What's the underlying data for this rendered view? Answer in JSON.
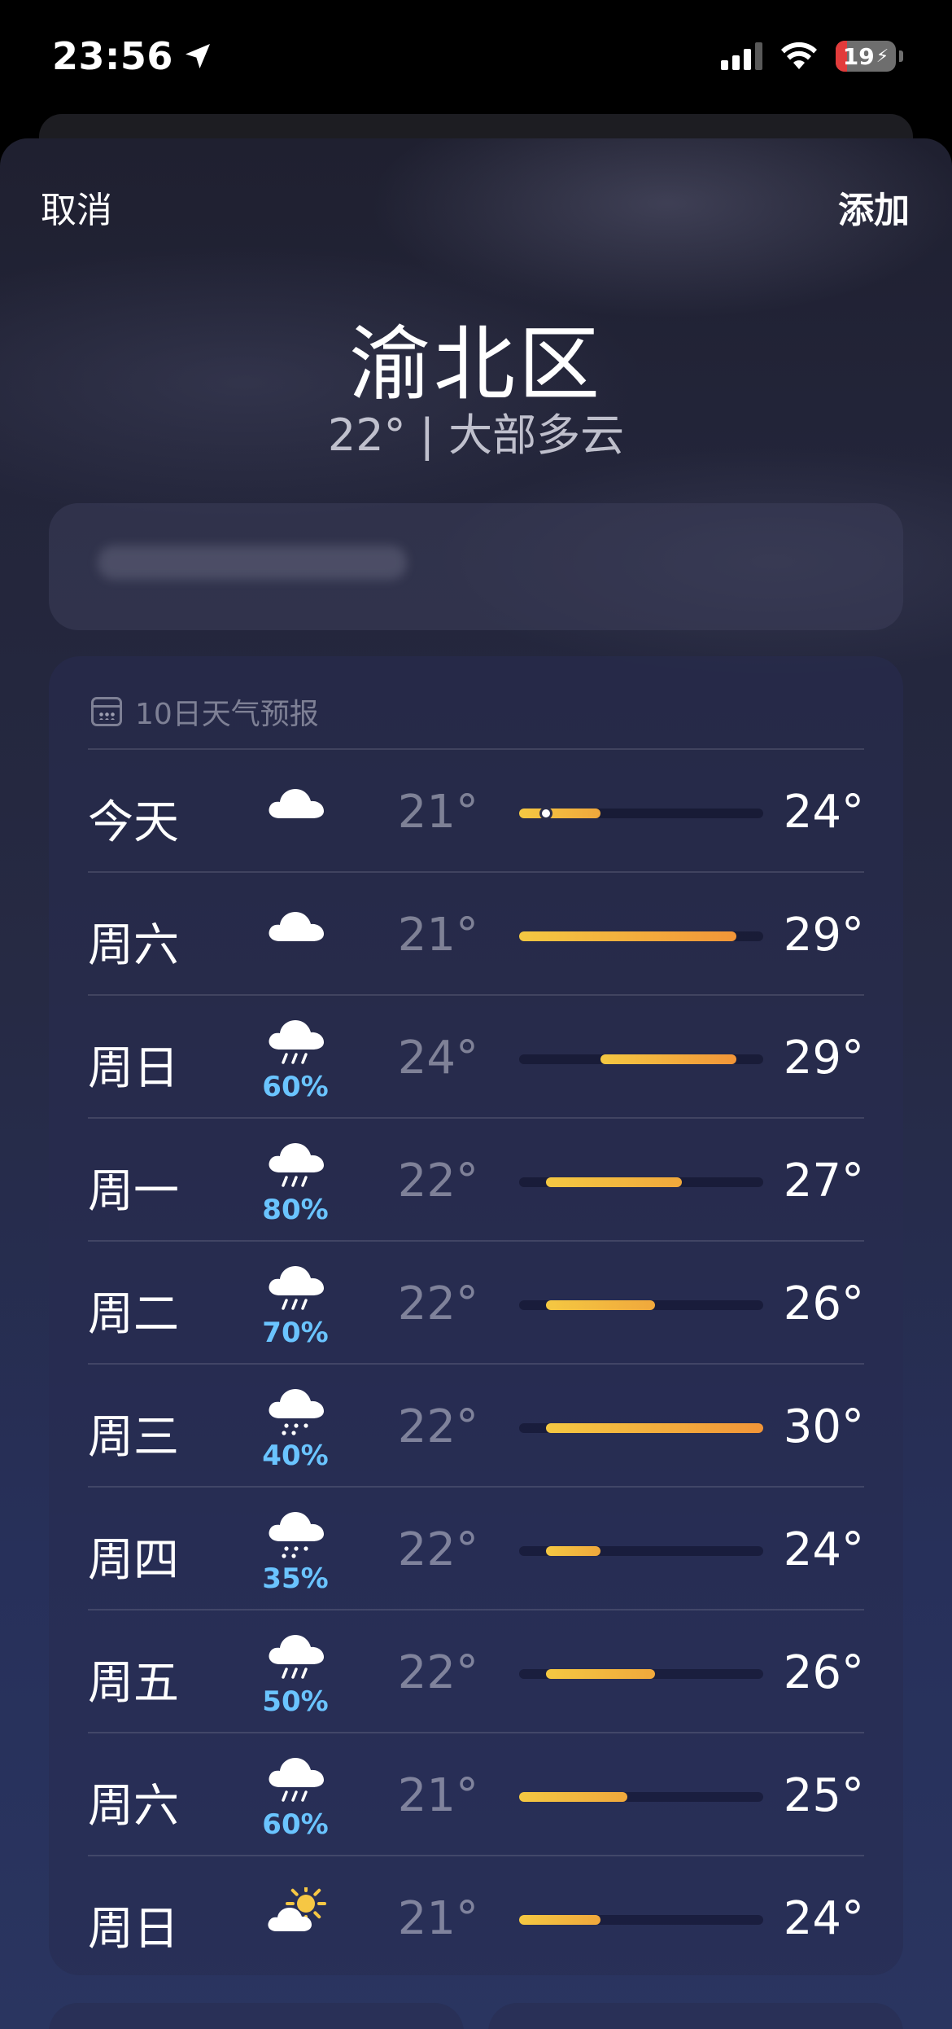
{
  "status": {
    "time": "23:56",
    "battery": "19"
  },
  "header": {
    "cancel": "取消",
    "add": "添加"
  },
  "location": {
    "city": "渝北区",
    "summary": "22° | 大部多云"
  },
  "forecast": {
    "title": "10日天气预报",
    "scale_min": 21,
    "scale_max": 30,
    "current_temp": 22,
    "days": [
      {
        "day": "今天",
        "icon": "cloud-icon",
        "pop": "",
        "low": "21°",
        "high": "24°",
        "lo": 21,
        "hi": 24
      },
      {
        "day": "周六",
        "icon": "cloud-icon",
        "pop": "",
        "low": "21°",
        "high": "29°",
        "lo": 21,
        "hi": 29
      },
      {
        "day": "周日",
        "icon": "cloud-rain-icon",
        "pop": "60%",
        "low": "24°",
        "high": "29°",
        "lo": 24,
        "hi": 29
      },
      {
        "day": "周一",
        "icon": "cloud-rain-icon",
        "pop": "80%",
        "low": "22°",
        "high": "27°",
        "lo": 22,
        "hi": 27
      },
      {
        "day": "周二",
        "icon": "cloud-rain-icon",
        "pop": "70%",
        "low": "22°",
        "high": "26°",
        "lo": 22,
        "hi": 26
      },
      {
        "day": "周三",
        "icon": "cloud-drizzle-icon",
        "pop": "40%",
        "low": "22°",
        "high": "30°",
        "lo": 22,
        "hi": 30
      },
      {
        "day": "周四",
        "icon": "cloud-drizzle-icon",
        "pop": "35%",
        "low": "22°",
        "high": "24°",
        "lo": 22,
        "hi": 24
      },
      {
        "day": "周五",
        "icon": "cloud-rain-icon",
        "pop": "50%",
        "low": "22°",
        "high": "26°",
        "lo": 22,
        "hi": 26
      },
      {
        "day": "周六",
        "icon": "cloud-rain-icon",
        "pop": "60%",
        "low": "21°",
        "high": "25°",
        "lo": 21,
        "hi": 25
      },
      {
        "day": "周日",
        "icon": "partly-sunny-icon",
        "pop": "",
        "low": "21°",
        "high": "24°",
        "lo": 21,
        "hi": 24
      }
    ]
  },
  "colors": {
    "precip": "#6ac4ff",
    "bar_warm": "#f4c842",
    "bar_hot": "#f29538"
  }
}
